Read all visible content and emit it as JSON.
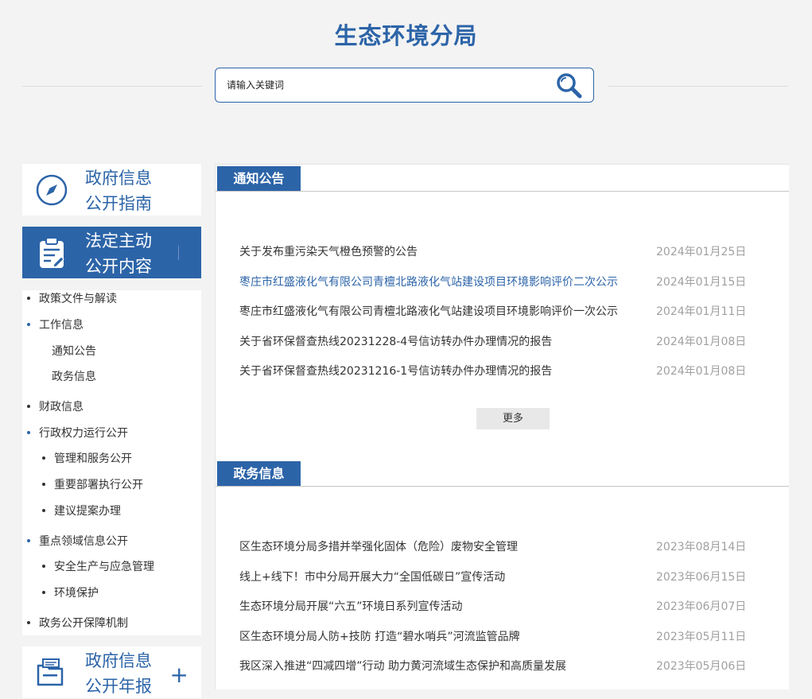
{
  "header": {
    "title": "生态环境分局"
  },
  "search": {
    "placeholder": "请输入关键词",
    "value": ""
  },
  "sidebar": {
    "guide_label_1": "政府信息",
    "guide_label_2": "公开指南",
    "active_label_1": "法定主动",
    "active_label_2": "公开内容",
    "annual_label_1": "政府信息",
    "annual_label_2": "公开年报",
    "plus": "+",
    "items": [
      "政策文件与解读",
      "工作信息",
      "通知公告",
      "政务信息",
      "财政信息",
      "行政权力运行公开",
      "管理和服务公开",
      "重要部署执行公开",
      "建议提案办理",
      "重点领域信息公开",
      "安全生产与应急管理",
      "环境保护",
      "政务公开保障机制"
    ]
  },
  "notice": {
    "title": "通知公告",
    "more": "更多",
    "items": [
      {
        "title": "关于发布重污染天气橙色预警的公告",
        "date": "2024年01月25日"
      },
      {
        "title": "枣庄市红盛液化气有限公司青檀北路液化气站建设项目环境影响评价二次公示",
        "date": "2024年01月15日"
      },
      {
        "title": "枣庄市红盛液化气有限公司青檀北路液化气站建设项目环境影响评价一次公示",
        "date": "2024年01月11日"
      },
      {
        "title": "关于省环保督查热线20231228-4号信访转办件办理情况的报告",
        "date": "2024年01月08日"
      },
      {
        "title": "关于省环保督查热线20231216-1号信访转办件办理情况的报告",
        "date": "2024年01月08日"
      }
    ]
  },
  "affairs": {
    "title": "政务信息",
    "items": [
      {
        "title": "区生态环境分局多措并举强化固体（危险）废物安全管理",
        "date": "2023年08月14日"
      },
      {
        "title": "线上+线下！市中分局开展大力“全国低碳日”宣传活动",
        "date": "2023年06月15日"
      },
      {
        "title": "生态环境分局开展“六五”环境日系列宣传活动",
        "date": "2023年06月07日"
      },
      {
        "title": "区生态环境分局人防+技防 打造“碧水哨兵”河流监管品牌",
        "date": "2023年05月11日"
      },
      {
        "title": "我区深入推进“四减四增”行动 助力黄河流域生态保护和高质量发展",
        "date": "2023年05月06日"
      }
    ]
  },
  "colors": {
    "brand": "#2c64a8",
    "background": "#f3f3f3",
    "date": "#a0a0a0"
  }
}
